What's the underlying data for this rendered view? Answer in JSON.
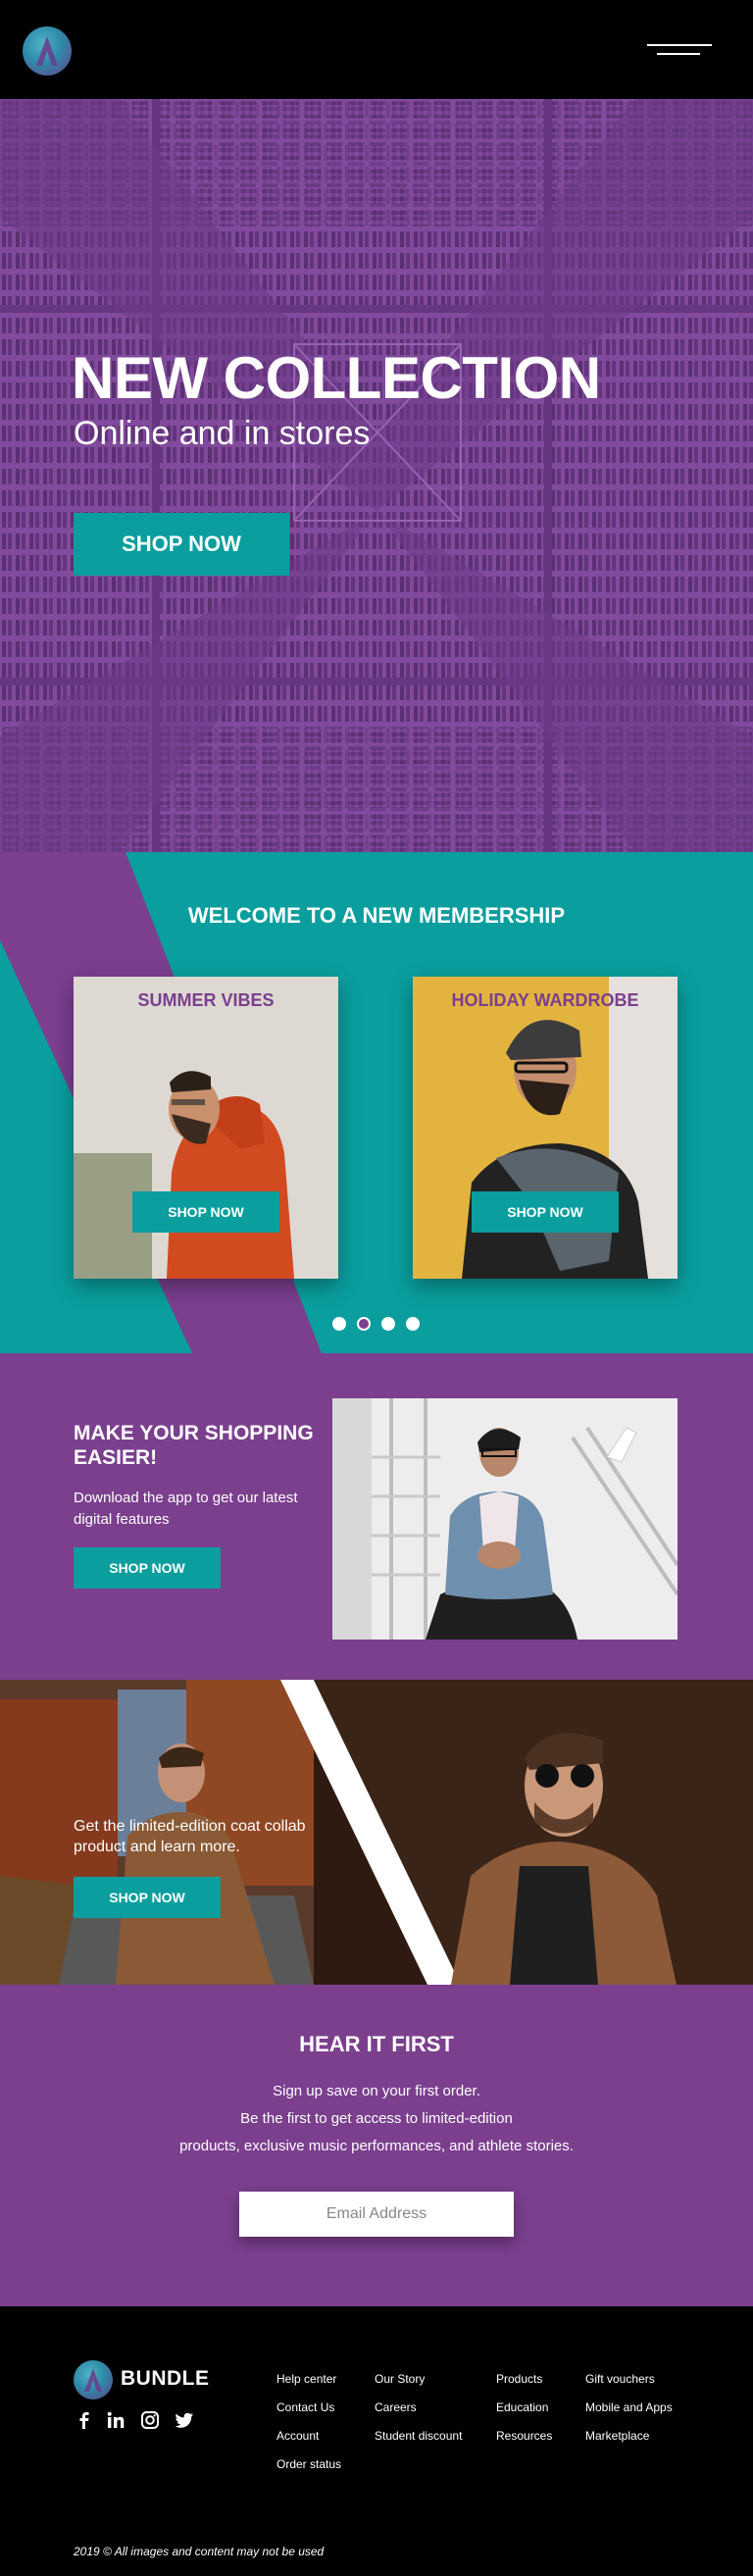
{
  "header": {
    "logo_icon": "bundle-logo-icon",
    "menu_icon": "hamburger-menu-icon"
  },
  "hero": {
    "title": "NEW COLLECTION",
    "subtitle": "Online and in stores",
    "button_label": "SHOP NOW"
  },
  "membership": {
    "title": "WELCOME TO A NEW MEMBERSHIP",
    "cards": [
      {
        "title": "SUMMER VIBES",
        "button_label": "SHOP NOW"
      },
      {
        "title": "HOLIDAY WARDROBE",
        "button_label": "SHOP NOW"
      }
    ],
    "carousel_dots": 4,
    "active_dot": 2
  },
  "app_section": {
    "title": "MAKE YOUR SHOPPING EASIER!",
    "text": "Download the app to get our latest digital features",
    "button_label": "SHOP NOW"
  },
  "collab": {
    "text": "Get the limited-edition coat collab product and learn more.",
    "button_label": "SHOP NOW"
  },
  "newsletter": {
    "title": "HEAR IT FIRST",
    "line1": "Sign up save on your first order.",
    "line2": "Be the first to get access to limited-edition",
    "line3": "products, exclusive music performances, and athlete stories.",
    "email_placeholder": "Email Address"
  },
  "footer": {
    "brand": "BUNDLE",
    "social_icons": [
      "facebook-icon",
      "linkedin-icon",
      "instagram-icon",
      "twitter-icon"
    ],
    "columns": [
      [
        "Help center",
        "Contact Us",
        "Account",
        "Order status"
      ],
      [
        "Our Story",
        "Careers",
        "Student discount"
      ],
      [
        "Products",
        "Education",
        "Resources"
      ],
      [
        "Gift vouchers",
        "Mobile and  Apps",
        "Marketplace"
      ]
    ],
    "copyright": "2019 © All images and content may not be used"
  },
  "colors": {
    "purple": "#7b3f8e",
    "teal": "#0a9e9e",
    "black": "#000000"
  }
}
